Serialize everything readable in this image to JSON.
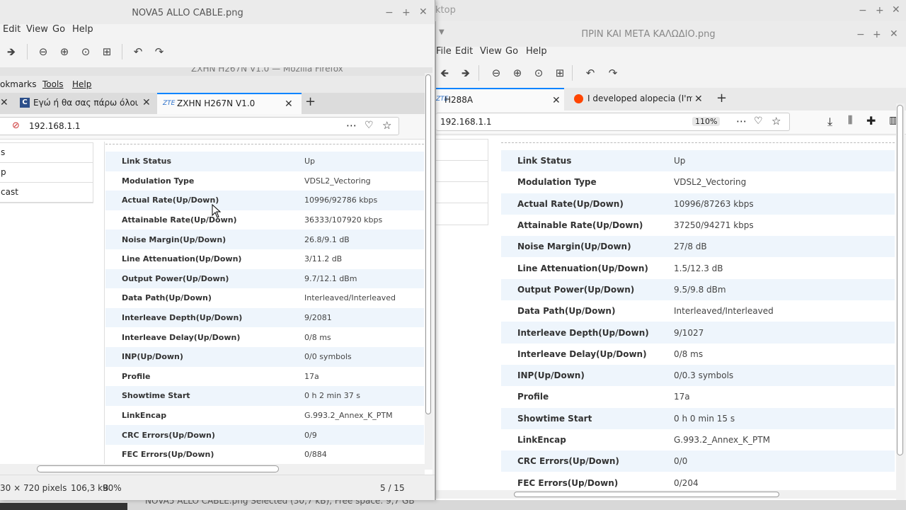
{
  "desktop_window": {
    "title": "ktop"
  },
  "right_window": {
    "title": "ΠΡΙΝ ΚΑΙ ΜΕΤΑ ΚΑΛΩΔΙΟ.png",
    "menu": [
      "File",
      "Edit",
      "View",
      "Go",
      "Help"
    ],
    "tabs": [
      {
        "label": "H288A",
        "icon": "zte-icon"
      },
      {
        "label": "I developed alopecia (I'm bal",
        "icon": "reddit-icon"
      }
    ],
    "url": "192.168.1.1",
    "zoom_badge": "110%",
    "stats": [
      [
        "Link Status",
        "Up"
      ],
      [
        "Modulation Type",
        "VDSL2_Vectoring"
      ],
      [
        "Actual Rate(Up/Down)",
        "10996/87263 kbps"
      ],
      [
        "Attainable Rate(Up/Down)",
        "37250/94271 kbps"
      ],
      [
        "Noise Margin(Up/Down)",
        "27/8 dB"
      ],
      [
        "Line Attenuation(Up/Down)",
        "1.5/12.3 dB"
      ],
      [
        "Output Power(Up/Down)",
        "9.5/9.8 dBm"
      ],
      [
        "Data Path(Up/Down)",
        "Interleaved/Interleaved"
      ],
      [
        "Interleave Depth(Up/Down)",
        "9/1027"
      ],
      [
        "Interleave Delay(Up/Down)",
        "0/8 ms"
      ],
      [
        "INP(Up/Down)",
        "0/0.3 symbols"
      ],
      [
        "Profile",
        "17a"
      ],
      [
        "Showtime Start",
        "0 h 0 min 15 s"
      ],
      [
        "LinkEncap",
        "G.993.2_Annex_K_PTM"
      ],
      [
        "CRC Errors(Up/Down)",
        "0/0"
      ],
      [
        "FEC Errors(Up/Down)",
        "0/204"
      ]
    ]
  },
  "left_window": {
    "title": "NOVA5 ALLO CABLE.png",
    "menu": [
      "Edit",
      "View",
      "Go",
      "Help"
    ],
    "ff_title": "ZXHN H267N V1.0 — Mozilla Firefox",
    "ff_menu": [
      "okmarks",
      "Tools",
      "Help"
    ],
    "tabs": [
      {
        "label": "Εγώ ή θα σας πάρω όλους μα",
        "icon": "c-site-icon"
      },
      {
        "label": "ZXHN H267N V1.0",
        "icon_text": "ZTE"
      }
    ],
    "url": "192.168.1.1",
    "side_items": [
      "s",
      "p",
      "cast"
    ],
    "stats": [
      [
        "Link Status",
        "Up"
      ],
      [
        "Modulation Type",
        "VDSL2_Vectoring"
      ],
      [
        "Actual Rate(Up/Down)",
        "10996/92786 kbps"
      ],
      [
        "Attainable Rate(Up/Down)",
        "36333/107920 kbps"
      ],
      [
        "Noise Margin(Up/Down)",
        "26.8/9.1 dB"
      ],
      [
        "Line Attenuation(Up/Down)",
        "3/11.2 dB"
      ],
      [
        "Output Power(Up/Down)",
        "9.7/12.1 dBm"
      ],
      [
        "Data Path(Up/Down)",
        "Interleaved/Interleaved"
      ],
      [
        "Interleave Depth(Up/Down)",
        "9/2081"
      ],
      [
        "Interleave Delay(Up/Down)",
        "0/8 ms"
      ],
      [
        "INP(Up/Down)",
        "0/0 symbols"
      ],
      [
        "Profile",
        "17a"
      ],
      [
        "Showtime Start",
        "0 h 2 min 37 s"
      ],
      [
        "LinkEncap",
        "G.993.2_Annex_K_PTM"
      ],
      [
        "CRC Errors(Up/Down)",
        "0/9"
      ],
      [
        "FEC Errors(Up/Down)",
        "0/884"
      ]
    ],
    "status": {
      "dimensions": "30 × 720 pixels",
      "size": "106,3 kB",
      "zoom": "90%",
      "position": "5 / 15"
    }
  },
  "taskbar": {
    "text": "NOVA5 ALLO CABLE.png  Selected (30,7 kB), Free space: 9,7 GB"
  }
}
